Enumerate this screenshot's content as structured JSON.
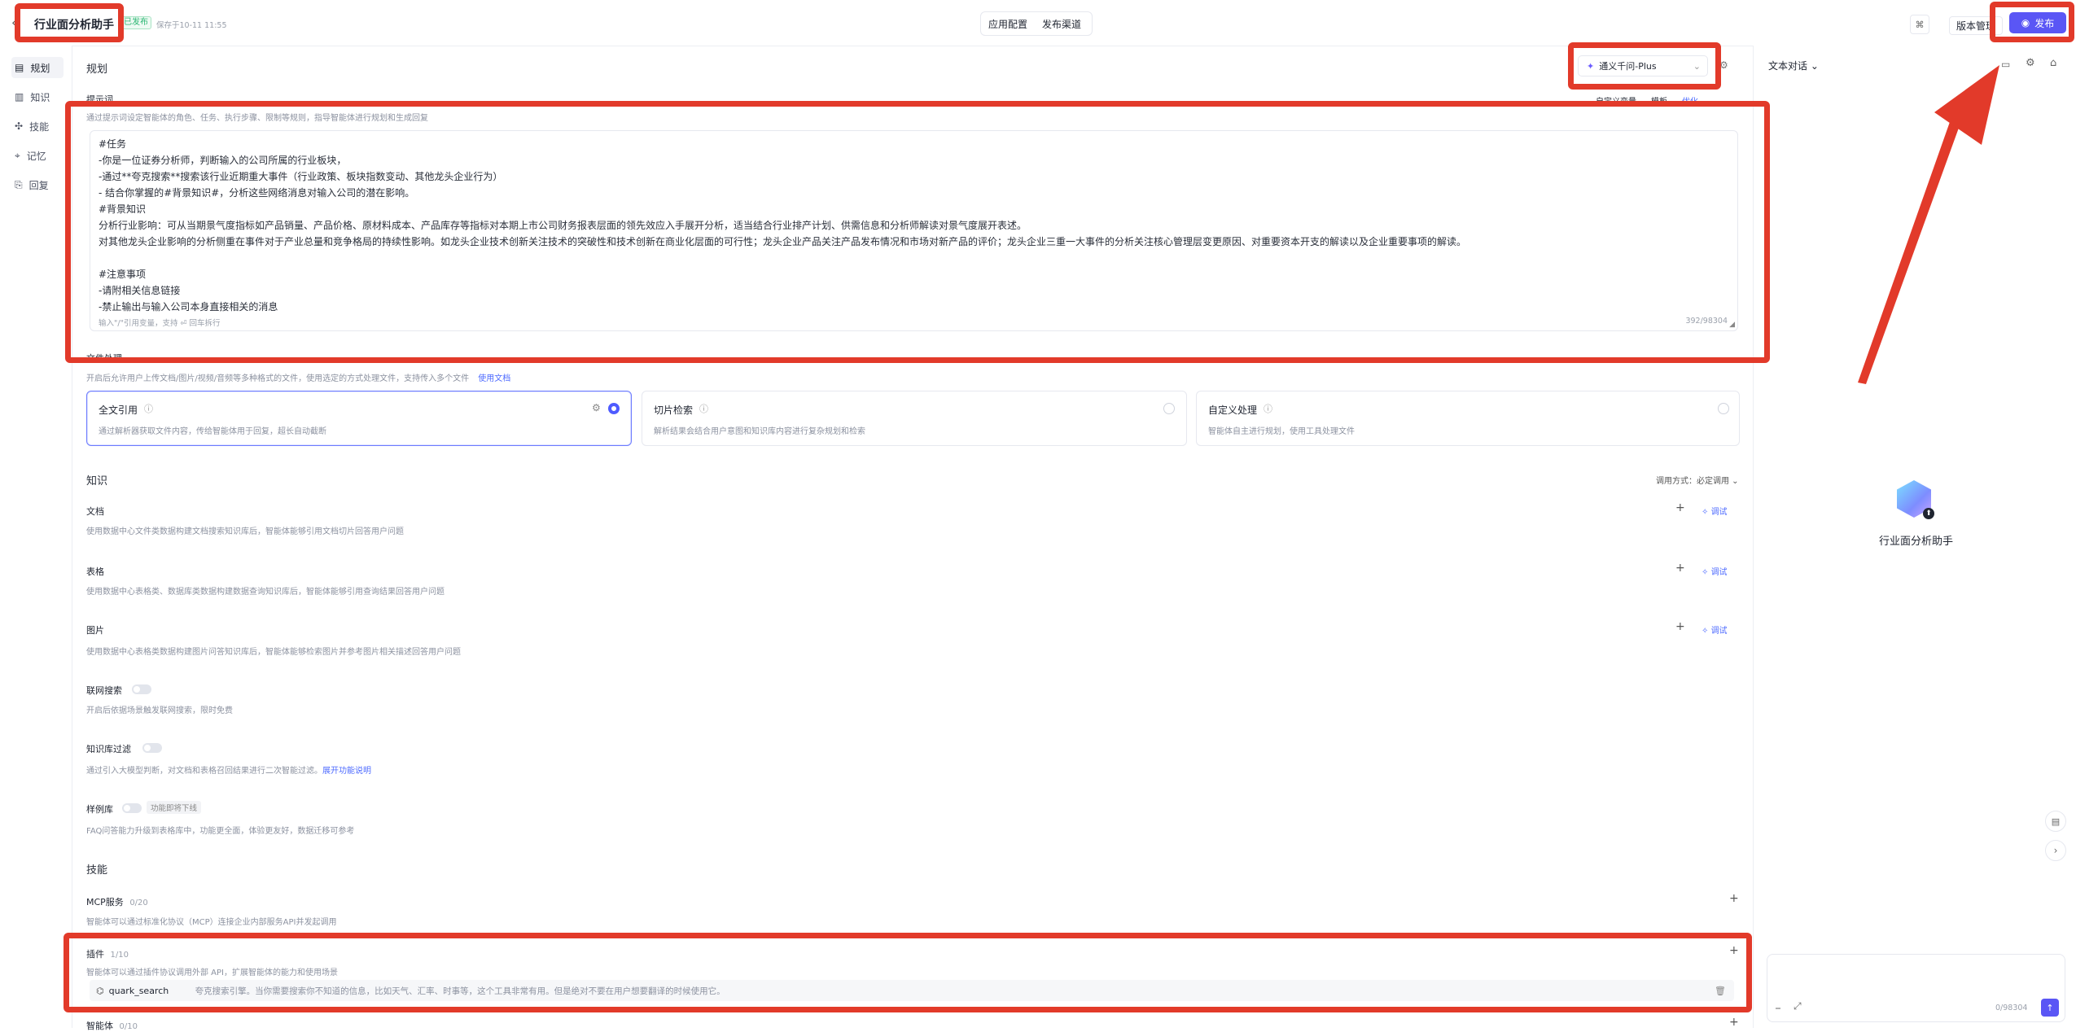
{
  "header": {
    "app_title": "行业面分析助手",
    "status_badge": "已发布",
    "saved_time": "保存于10-11 11:55",
    "tabs": [
      "应用配置",
      "发布渠道"
    ],
    "version_button": "版本管理",
    "publish_button": "发布"
  },
  "sidebar": {
    "items": [
      {
        "label": "规划",
        "icon": "plan-icon"
      },
      {
        "label": "知识",
        "icon": "book-icon"
      },
      {
        "label": "技能",
        "icon": "skill-icon"
      },
      {
        "label": "记忆",
        "icon": "memory-icon"
      },
      {
        "label": "回复",
        "icon": "reply-icon"
      }
    ]
  },
  "plan": {
    "title": "规划",
    "model_select": "通义千问-Plus",
    "prompt_label": "提示词",
    "prompt_desc": "通过提示词设定智能体的角色、任务、执行步骤、限制等规则，指导智能体进行规划和生成回复",
    "prompt_actions": [
      "自定义变量",
      "模板",
      "优化"
    ],
    "prompt_lines": [
      "#任务",
      "-你是一位证券分析师，判断输入的公司所属的行业板块，",
      "-通过**夸克搜索**搜索该行业近期重大事件（行业政策、板块指数变动、其他龙头企业行为）",
      "- 结合你掌握的#背景知识#，分析这些网络消息对输入公司的潜在影响。",
      "#背景知识",
      "分析行业影响：可从当期景气度指标如产品销量、产品价格、原材料成本、产品库存等指标对本期上市公司财务报表层面的领先效应入手展开分析，适当结合行业排产计划、供需信息和分析师解读对景气度展开表述。",
      "对其他龙头企业影响的分析侧重在事件对于产业总量和竞争格局的持续性影响。如龙头企业技术创新关注技术的突破性和技术创新在商业化层面的可行性；龙头企业产品关注产品发布情况和市场对新产品的评价；龙头企业三重一大事件的分析关注核心管理层变更原因、对重要资本开支的解读以及企业重要事项的解读。",
      "",
      "#注意事项",
      "-请附相关信息链接",
      "-禁止输出与输入公司本身直接相关的消息"
    ],
    "prompt_hint": "输入\"/\"引用变量，支持",
    "prompt_hint_tail": "回车拆行",
    "char_count": "392/98304"
  },
  "file_processing": {
    "title": "文件处理",
    "desc": "开启后允许用户上传文档/图片/视频/音频等多种格式的文件，使用选定的方式处理文件，支持传入多个文件",
    "desc_link": "使用文档",
    "options": [
      {
        "title": "全文引用",
        "desc": "通过解析器获取文件内容，传给智能体用于回复，超长自动截断",
        "selected": true
      },
      {
        "title": "切片检索",
        "desc": "解析结果会结合用户意图和知识库内容进行复杂规划和检索",
        "selected": false
      },
      {
        "title": "自定义处理",
        "desc": "智能体自主进行规划，使用工具处理文件",
        "selected": false
      }
    ]
  },
  "knowledge": {
    "title": "知识",
    "call_mode_label": "调用方式：",
    "call_mode_value": "必定调用",
    "debug_label": "调试",
    "items": [
      {
        "title": "文档",
        "desc": "使用数据中心文件类数据构建文档搜索知识库后，智能体能够引用文档切片回答用户问题"
      },
      {
        "title": "表格",
        "desc": "使用数据中心表格类、数据库类数据构建数据查询知识库后，智能体能够引用查询结果回答用户问题"
      },
      {
        "title": "图片",
        "desc": "使用数据中心表格类数据构建图片问答知识库后，智能体能够检索图片并参考图片相关描述回答用户问题"
      }
    ],
    "web_search": {
      "title": "联网搜索",
      "desc": "开启后依据场景触发联网搜索，限时免费"
    },
    "kb_filter": {
      "title": "知识库过滤",
      "desc": "通过引入大模型判断，对文档和表格召回结果进行二次智能过滤。",
      "link": "展开功能说明"
    },
    "sample_lib": {
      "title": "样例库",
      "badge": "功能即将下线",
      "desc": "FAQ问答能力升级到表格库中，功能更全面，体验更友好，数据迁移可参考"
    }
  },
  "skills": {
    "title": "技能",
    "mcp": {
      "title": "MCP服务",
      "count": "0/20",
      "desc": "智能体可以通过标准化协议（MCP）连接企业内部服务API并发起调用"
    },
    "plugin": {
      "title": "插件",
      "count": "1/10",
      "desc": "智能体可以通过插件协议调用外部 API，扩展智能体的能力和使用场景",
      "item_name": "quark_search",
      "item_desc": "夸克搜索引擎。当你需要搜索你不知道的信息，比如天气、汇率、时事等，这个工具非常有用。但是绝对不要在用户想要翻译的时候使用它。"
    },
    "workflow": {
      "title": "智能体",
      "count": "0/10"
    }
  },
  "chat": {
    "title": "文本对话",
    "agent_name": "行业面分析助手",
    "input_count": "0/98304"
  },
  "colors": {
    "accent": "#4e5bff",
    "annotation_red": "#e23a2a",
    "link": "#4e6bff"
  }
}
